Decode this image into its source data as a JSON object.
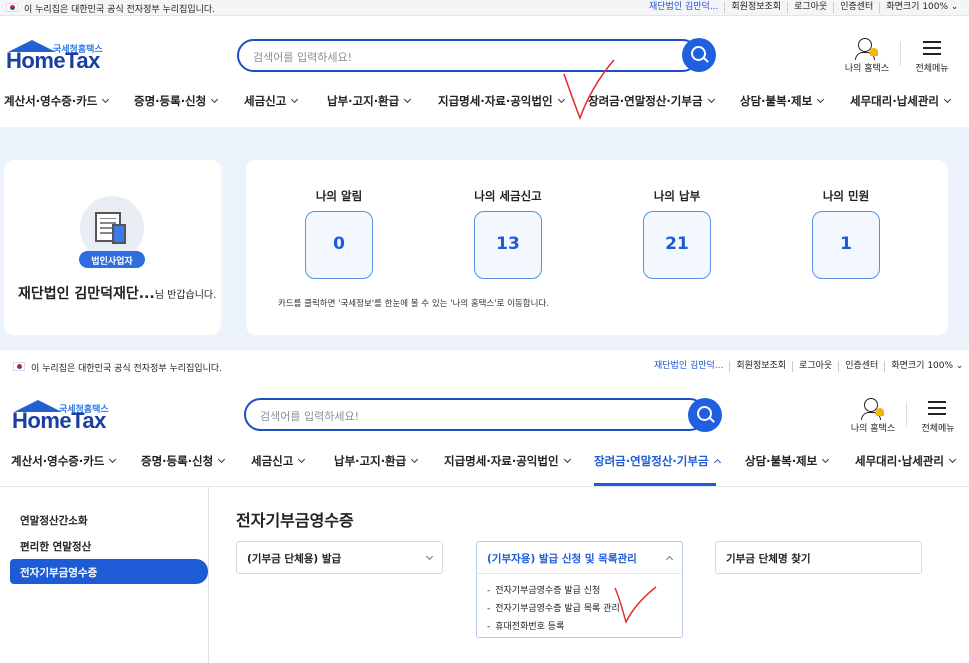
{
  "gov_notice": "이 누리집은 대한민국 공식 전자정부 누리집입니다.",
  "top_links": {
    "org_name": "재단법인 김만덕...",
    "org_name_b": "재단법인 김만덕...",
    "member_info": "회원정보조회",
    "logout": "로그아웃",
    "cert_center": "인증센터",
    "screen_size": "화면크기 100% ⌄"
  },
  "logo": {
    "top_text": "국세청홈택스",
    "main_text": "HomeTax"
  },
  "search": {
    "placeholder": "검색어를 입력하세요!"
  },
  "header_icons": {
    "my_hometax": "나의 홈택스",
    "all_menu": "전체메뉴"
  },
  "nav": [
    {
      "label": "계산서·영수증·카드"
    },
    {
      "label": "증명·등록·신청"
    },
    {
      "label": "세금신고"
    },
    {
      "label": "납부·고지·환급"
    },
    {
      "label": "지급명세·자료·공익법인"
    },
    {
      "label": "장려금·연말정산·기부금"
    },
    {
      "label": "상담·불복·제보"
    },
    {
      "label": "세무대리·납세관리"
    }
  ],
  "profile": {
    "badge": "법인사업자",
    "name": "재단법인 김만덕재단...",
    "greeting_suffix": "님 반갑습니다."
  },
  "stats": [
    {
      "label": "나의 알림",
      "value": "0"
    },
    {
      "label": "나의 세금신고",
      "value": "13"
    },
    {
      "label": "나의 납부",
      "value": "21"
    },
    {
      "label": "나의 민원",
      "value": "1"
    }
  ],
  "stats_note": "카드를 클릭하면 '국세정보'를 한눈에 볼 수 있는 '나의 홈택스'로 이동합니다.",
  "sidebar": {
    "items": [
      {
        "label": "연말정산간소화"
      },
      {
        "label": "편리한 연말정산"
      },
      {
        "label": "전자기부금영수증"
      }
    ]
  },
  "page": {
    "title": "전자기부금영수증",
    "accordions": [
      {
        "label": "(기부금 단체용) 발급"
      },
      {
        "label": "(기부자용) 발급 신청 및 목록관리"
      },
      {
        "label": "기부금 단체명 찾기"
      }
    ],
    "sub_items": [
      "전자기부금영수증 발급 신청",
      "전자기부금영수증 발급 목록 관리",
      "휴대전화번호 등록"
    ]
  },
  "colors": {
    "primary": "#1e5bd6",
    "annotation": "#e03030"
  }
}
